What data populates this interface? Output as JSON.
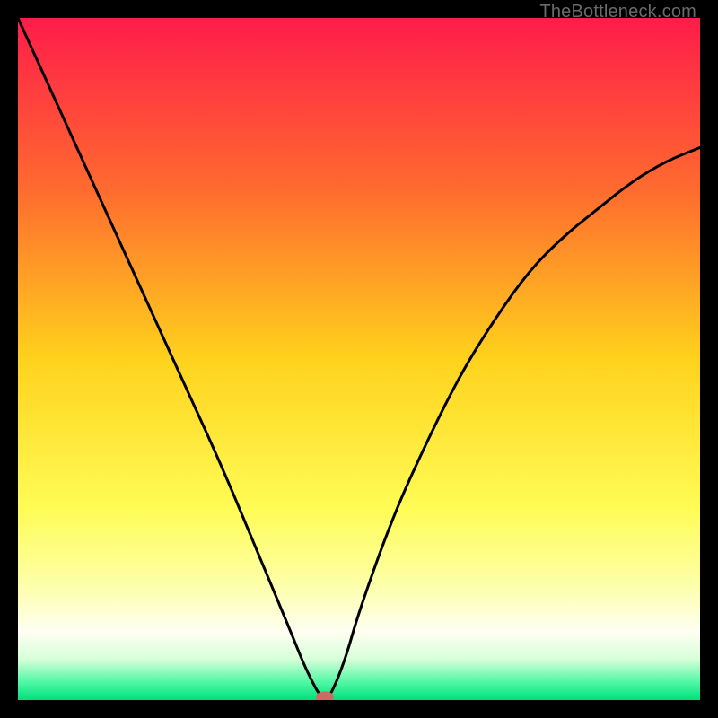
{
  "watermark": "TheBottleneck.com",
  "chart_data": {
    "type": "line",
    "title": "",
    "xlabel": "",
    "ylabel": "",
    "xlim": [
      0,
      100
    ],
    "ylim": [
      0,
      100
    ],
    "grid": false,
    "legend": null,
    "series": [
      {
        "name": "curve",
        "x": [
          0,
          5,
          10,
          15,
          20,
          25,
          30,
          35,
          40,
          42,
          44,
          45,
          46,
          48,
          50,
          55,
          60,
          65,
          70,
          75,
          80,
          85,
          90,
          95,
          100
        ],
        "y": [
          100,
          89,
          78,
          67,
          56,
          45,
          34,
          22,
          10,
          5,
          1,
          0,
          1,
          6,
          13,
          27,
          38,
          48,
          56,
          63,
          68,
          72,
          76,
          79,
          81
        ]
      }
    ],
    "marker": {
      "x": 45,
      "y": 0,
      "color": "#cf6a63",
      "rx": 10,
      "ry": 6
    },
    "gradient_stops": [
      {
        "pos": 0.0,
        "color": "#ff1c4a"
      },
      {
        "pos": 0.25,
        "color": "#ff6a2f"
      },
      {
        "pos": 0.5,
        "color": "#ffd21c"
      },
      {
        "pos": 0.72,
        "color": "#fffc56"
      },
      {
        "pos": 0.83,
        "color": "#fdffa8"
      },
      {
        "pos": 0.9,
        "color": "#fefff2"
      },
      {
        "pos": 0.94,
        "color": "#d7ffd9"
      },
      {
        "pos": 0.975,
        "color": "#4cf7a2"
      },
      {
        "pos": 1.0,
        "color": "#00e07b"
      }
    ],
    "background_color": "#000000"
  }
}
